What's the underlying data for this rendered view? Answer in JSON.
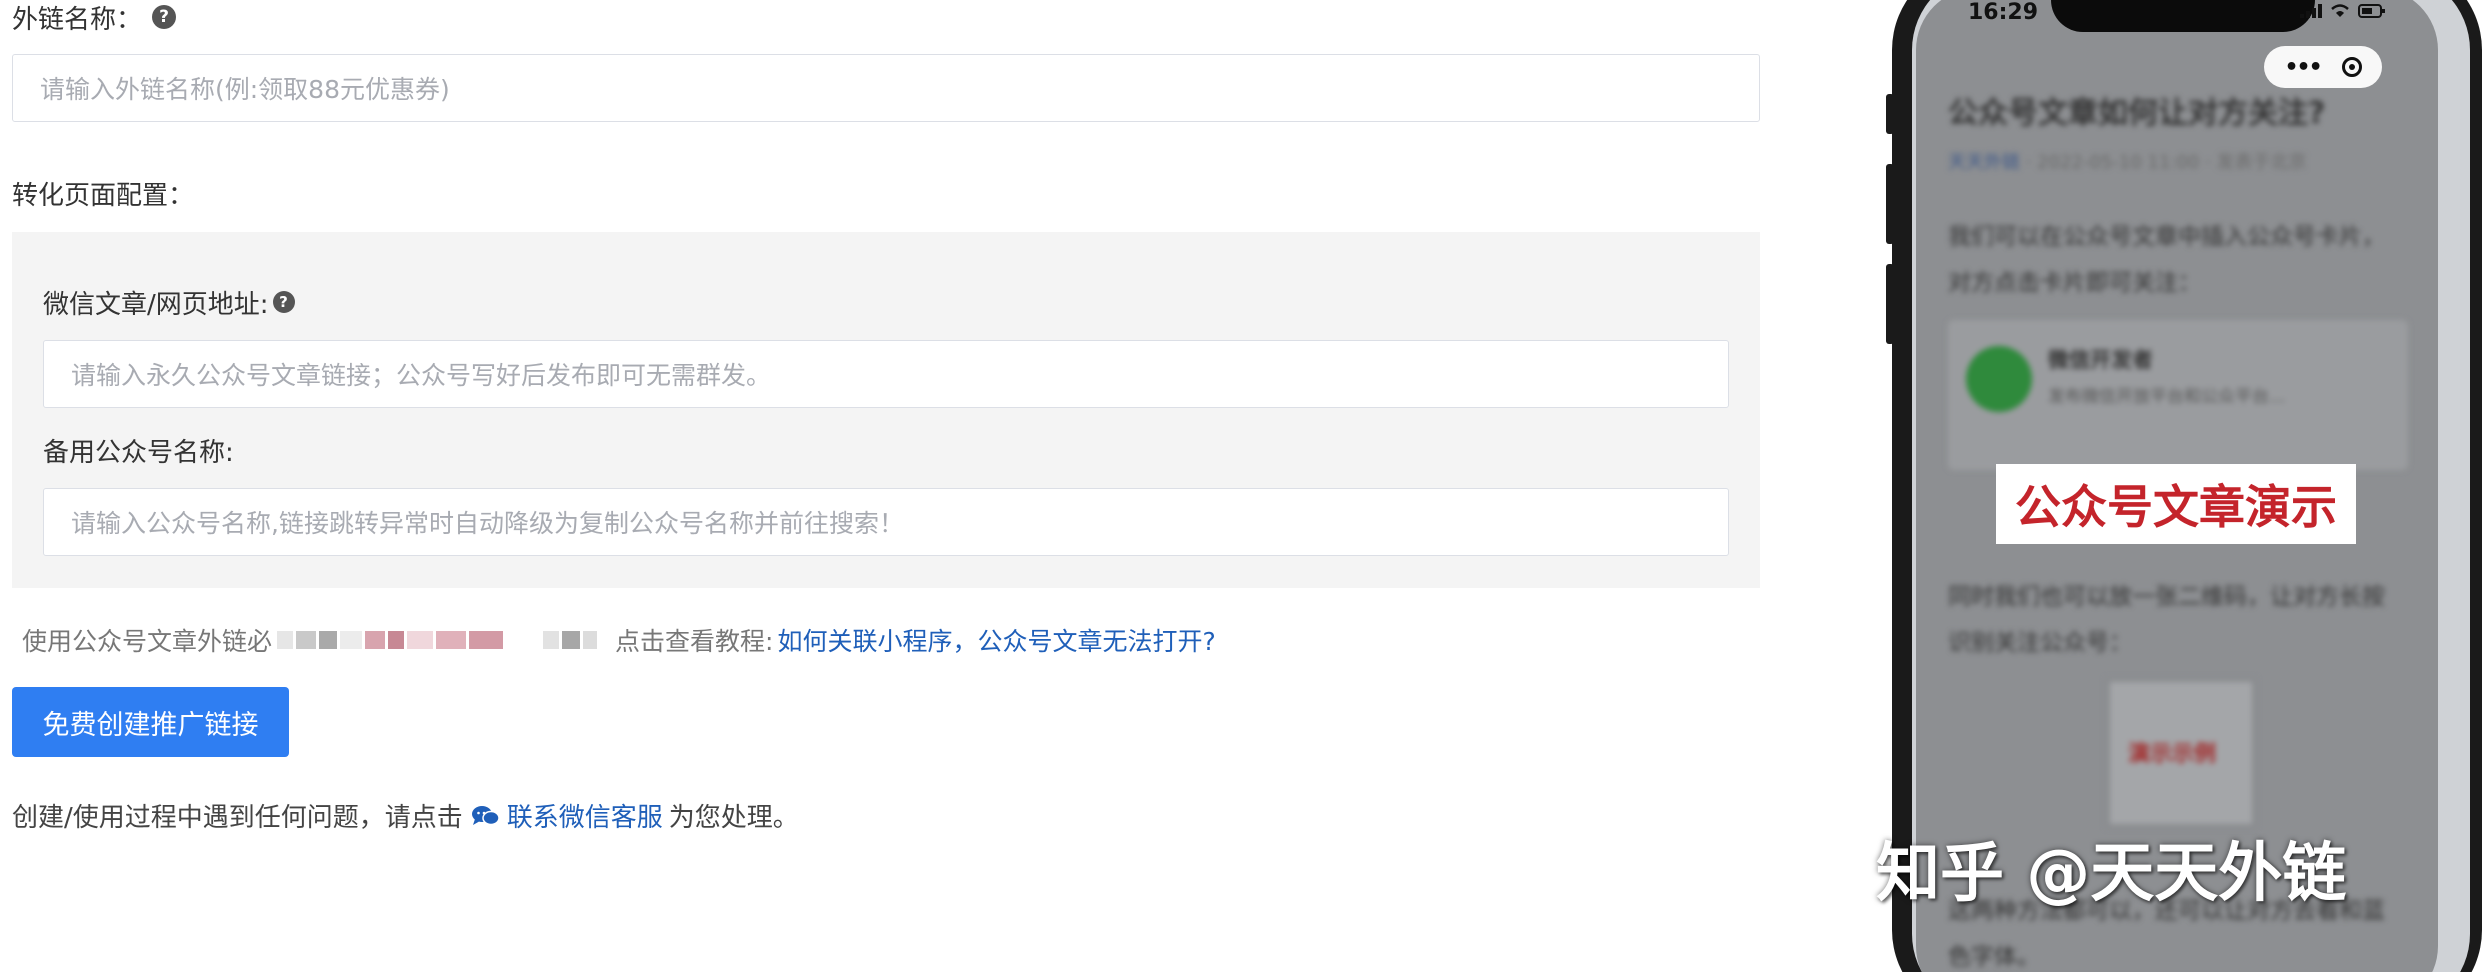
{
  "form": {
    "name_label": "外链名称：",
    "name_placeholder": "请输入外链名称(例:领取88元优惠券)",
    "conversion_label": "转化页面配置：",
    "article_label": "微信文章/网页地址:",
    "article_placeholder": "请输入永久公众号文章链接；公众号写好后发布即可无需群发。",
    "backup_label": "备用公众号名称:",
    "backup_placeholder": "请输入公众号名称,链接跳转异常时自动降级为复制公众号名称并前往搜索！",
    "help_glyph": "?"
  },
  "note": {
    "prefix": "使用公众号文章外链必",
    "tutorial_prefix": "点击查看教程:",
    "tutorial_link": "如何关联小程序，公众号文章无法打开?",
    "link_color": "#1f5fb9"
  },
  "create_button": {
    "label": "免费创建推广链接",
    "color": "#2f7ef2"
  },
  "support": {
    "prefix": "创建/使用过程中遇到任何问题，请点击",
    "link": "联系微信客服",
    "suffix": "为您处理。",
    "icon": "chat-bubble-icon"
  },
  "phone": {
    "time": "16:29",
    "article_title": "公众号文章如何让对方关注?",
    "article_account": "天天外链",
    "article_meta": "· 2022-05-10 11:00 · 发表于北京",
    "paragraph1": "我们可以在公众号文章中插入公众号卡片，对方点击卡片即可关注：",
    "card_name": "微信开发者",
    "card_desc": "发布微信开放平台和公众平台...",
    "paragraph2": "同时我们也可以放一张二维码，让对方长按识别关注公众号：",
    "qr_label": "演示示例",
    "paragraph3": "这两种方法都可以，还可以让对方去看和蓝色字体。",
    "banner": "公众号文章演示",
    "banner_color": "#c4242b"
  },
  "watermark": "知乎 @天天外链"
}
